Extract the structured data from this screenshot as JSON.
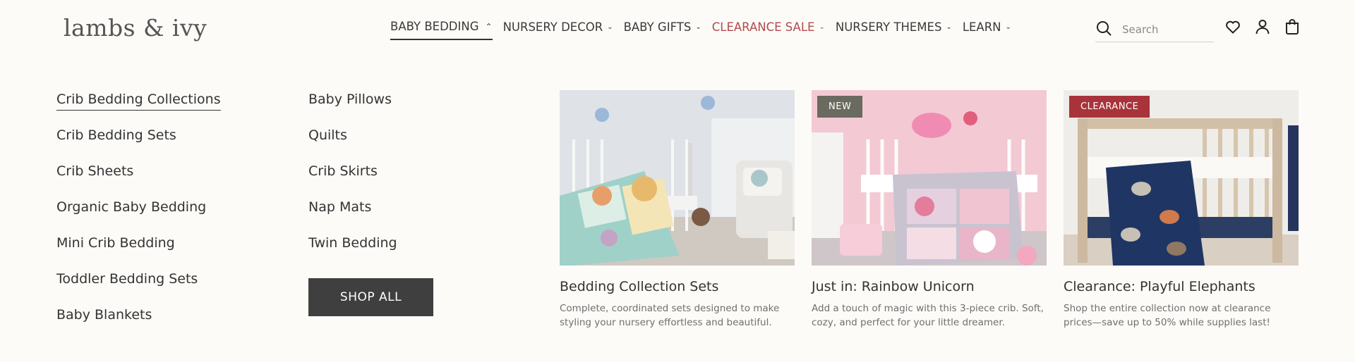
{
  "brand": {
    "logo_text": "lambs & ivy"
  },
  "nav": {
    "items": [
      {
        "label": "BABY BEDDING"
      },
      {
        "label": "NURSERY DECOR"
      },
      {
        "label": "BABY GIFTS"
      },
      {
        "label": "CLEARANCE SALE"
      },
      {
        "label": "NURSERY THEMES"
      },
      {
        "label": "LEARN"
      }
    ]
  },
  "header": {
    "search_placeholder": "Search",
    "icons": [
      "heart-icon",
      "user-icon",
      "bag-icon"
    ]
  },
  "menu": {
    "col1": [
      "Crib Bedding Collections",
      "Crib Bedding Sets",
      "Crib Sheets",
      "Organic Baby Bedding",
      "Mini Crib Bedding",
      "Toddler Bedding Sets",
      "Baby Blankets"
    ],
    "col2": [
      "Baby Pillows",
      "Quilts",
      "Crib Skirts",
      "Nap Mats",
      "Twin Bedding"
    ],
    "shop_all": "SHOP ALL"
  },
  "promos": [
    {
      "title": "Bedding Collection Sets",
      "desc": "Complete, coordinated sets designed to make styling your nursery effortless and beautiful.",
      "badge": ""
    },
    {
      "title": "Just in: Rainbow Unicorn",
      "desc": "Add a touch of magic with this 3-piece crib. Soft, cozy, and perfect for your little dreamer.",
      "badge": "NEW"
    },
    {
      "title": "Clearance: Playful Elephants",
      "desc": "Shop the entire collection now at clearance prices—save up to 50% while supplies last!",
      "badge": "CLEARANCE"
    }
  ],
  "colors": {
    "background": "#fcfbf8",
    "sale_red": "#b24a4f",
    "badge_new": "#6a6a5e",
    "badge_clearance": "#a8333a",
    "button_dark": "#3f3f3f"
  }
}
